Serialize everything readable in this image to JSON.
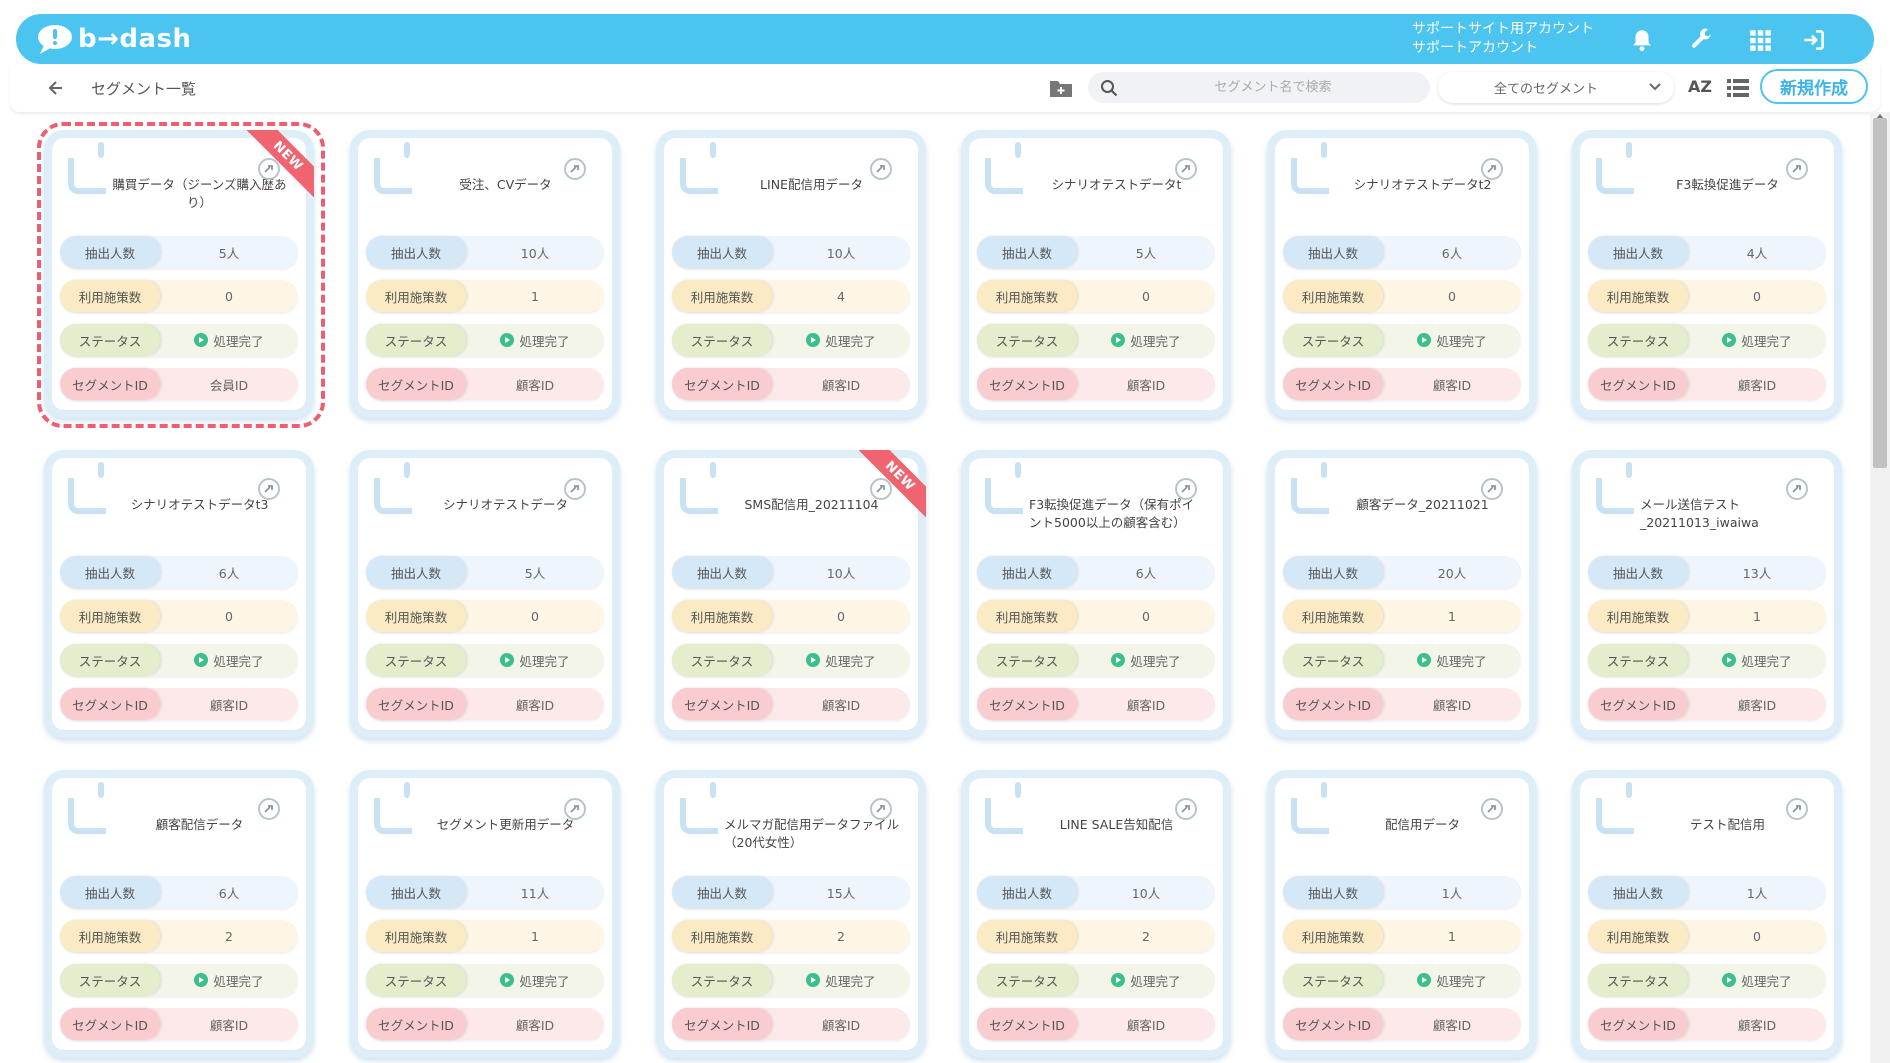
{
  "header": {
    "logo_text": "b→dash",
    "account_line1": "サポートサイト用アカウント",
    "account_line2": "サポートアカウント",
    "icons": [
      "bell-icon",
      "wrench-icon",
      "grid-icon",
      "logout-icon"
    ],
    "accent_color": "#4cc4f0"
  },
  "subbar": {
    "breadcrumb": "セグメント一覧",
    "search_placeholder": "セグメント名で検索",
    "filter_selected": "全てのセグメント",
    "sort_label": "AZ",
    "new_button": "新規作成"
  },
  "labels": {
    "count": "抽出人数",
    "measures": "利用施策数",
    "status": "ステータス",
    "segment_id": "セグメントID"
  },
  "cards": [
    {
      "title": "購買データ（ジーンズ購入歴あり）",
      "count": "5人",
      "measures": "0",
      "status": "処理完了",
      "segment_id": "会員ID",
      "new": true,
      "new_label": "NEW",
      "selected": true
    },
    {
      "title": "受注、CVデータ",
      "count": "10人",
      "measures": "1",
      "status": "処理完了",
      "segment_id": "顧客ID",
      "new": false
    },
    {
      "title": "LINE配信用データ",
      "count": "10人",
      "measures": "4",
      "status": "処理完了",
      "segment_id": "顧客ID",
      "new": false
    },
    {
      "title": "シナリオテストデータt",
      "count": "5人",
      "measures": "0",
      "status": "処理完了",
      "segment_id": "顧客ID",
      "new": false
    },
    {
      "title": "シナリオテストデータt2",
      "count": "6人",
      "measures": "0",
      "status": "処理完了",
      "segment_id": "顧客ID",
      "new": false
    },
    {
      "title": "F3転換促進データ",
      "count": "4人",
      "measures": "0",
      "status": "処理完了",
      "segment_id": "顧客ID",
      "new": false
    },
    {
      "title": "シナリオテストデータt3",
      "count": "6人",
      "measures": "0",
      "status": "処理完了",
      "segment_id": "顧客ID",
      "new": false
    },
    {
      "title": "シナリオテストデータ",
      "count": "5人",
      "measures": "0",
      "status": "処理完了",
      "segment_id": "顧客ID",
      "new": false
    },
    {
      "title": "SMS配信用_20211104",
      "count": "10人",
      "measures": "0",
      "status": "処理完了",
      "segment_id": "顧客ID",
      "new": true,
      "new_label": "NEW"
    },
    {
      "title": "F3転換促進データ（保有ポイント5000以上の顧客含む）",
      "count": "6人",
      "measures": "0",
      "status": "処理完了",
      "segment_id": "顧客ID",
      "new": false
    },
    {
      "title": "顧客データ_20211021",
      "count": "20人",
      "measures": "1",
      "status": "処理完了",
      "segment_id": "顧客ID",
      "new": false
    },
    {
      "title": "メール送信テスト_20211013_iwaiwa",
      "count": "13人",
      "measures": "1",
      "status": "処理完了",
      "segment_id": "顧客ID",
      "new": false
    },
    {
      "title": "顧客配信データ",
      "count": "6人",
      "measures": "2",
      "status": "処理完了",
      "segment_id": "顧客ID",
      "new": false
    },
    {
      "title": "セグメント更新用データ",
      "count": "11人",
      "measures": "1",
      "status": "処理完了",
      "segment_id": "顧客ID",
      "new": false
    },
    {
      "title": "メルマガ配信用データファイル（20代女性）",
      "count": "15人",
      "measures": "2",
      "status": "処理完了",
      "segment_id": "顧客ID",
      "new": false
    },
    {
      "title": "LINE SALE告知配信",
      "count": "10人",
      "measures": "2",
      "status": "処理完了",
      "segment_id": "顧客ID",
      "new": false
    },
    {
      "title": "配信用データ",
      "count": "1人",
      "measures": "1",
      "status": "処理完了",
      "segment_id": "顧客ID",
      "new": false
    },
    {
      "title": "テスト配信用",
      "count": "1人",
      "measures": "0",
      "status": "処理完了",
      "segment_id": "顧客ID",
      "new": false
    }
  ]
}
